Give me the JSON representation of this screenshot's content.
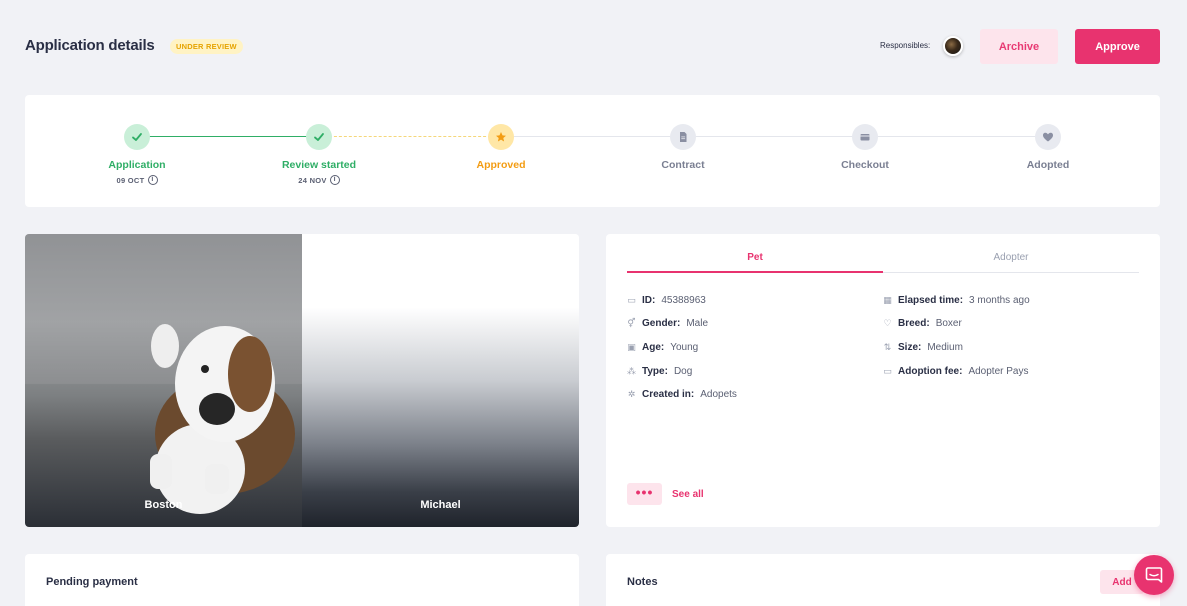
{
  "header": {
    "title": "Application details",
    "status_badge": "UNDER REVIEW",
    "responsibles_label": "Responsibles:",
    "archive_label": "Archive",
    "approve_label": "Approve"
  },
  "stepper": {
    "steps": [
      {
        "label": "Application",
        "date": "09 OCT",
        "state": "done",
        "icon": "check-icon"
      },
      {
        "label": "Review started",
        "date": "24 NOV",
        "state": "done",
        "icon": "check-icon"
      },
      {
        "label": "Approved",
        "date": "",
        "state": "current",
        "icon": "star-icon"
      },
      {
        "label": "Contract",
        "date": "",
        "state": "pending",
        "icon": "document-icon"
      },
      {
        "label": "Checkout",
        "date": "",
        "state": "pending",
        "icon": "wallet-icon"
      },
      {
        "label": "Adopted",
        "date": "",
        "state": "pending",
        "icon": "heart-icon"
      }
    ],
    "info_glyph": "i"
  },
  "photos": {
    "left_name": "Boston",
    "right_name": "Michael"
  },
  "pet_panel": {
    "tabs": [
      "Pet",
      "Adopter"
    ],
    "fields_left": [
      {
        "label": "ID:",
        "value": "45388963",
        "icon": "card-icon"
      },
      {
        "label": "Gender:",
        "value": "Male",
        "icon": "gender-icon"
      },
      {
        "label": "Age:",
        "value": "Young",
        "icon": "calendar-icon"
      },
      {
        "label": "Type:",
        "value": "Dog",
        "icon": "paw-icon"
      },
      {
        "label": "Created in:",
        "value": "Adopets",
        "icon": "sparkle-icon"
      }
    ],
    "fields_right": [
      {
        "label": "Elapsed time:",
        "value": "3 months ago",
        "icon": "calendar-icon"
      },
      {
        "label": "Breed:",
        "value": "Boxer",
        "icon": "heart-outline-icon"
      },
      {
        "label": "Size:",
        "value": "Medium",
        "icon": "size-icon"
      },
      {
        "label": "Adoption fee:",
        "value": "Adopter Pays",
        "icon": "money-icon"
      }
    ],
    "more_label": "•••",
    "see_all_label": "See all"
  },
  "payment": {
    "title": "Pending payment"
  },
  "notes": {
    "title": "Notes",
    "add_label": "Add"
  },
  "colors": {
    "accent": "#e8336f",
    "success": "#2fae66",
    "warning": "#f39c12"
  }
}
